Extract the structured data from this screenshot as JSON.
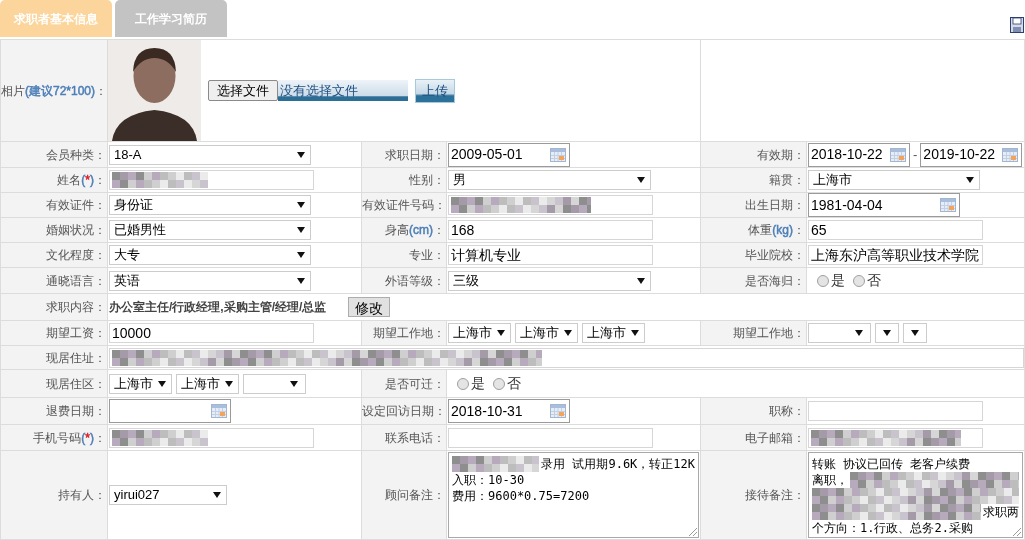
{
  "tabs": [
    {
      "label": "求职者基本信息",
      "selected": true
    },
    {
      "label": "工作学习简历",
      "selected": false
    }
  ],
  "form": {
    "rows": [
      {
        "fields": [
          {
            "label": [
              {
                "text": "相片"
              },
              {
                "text": "(建议72*100)",
                "color": "#4d7fb7"
              },
              {
                "text": "："
              }
            ],
            "kind": "photo",
            "choose_button": "选择文件",
            "file_status": "没有选择文件",
            "upload_button": "上传"
          }
        ]
      },
      {
        "fields": [
          {
            "label": "会员种类：",
            "kind": "select",
            "value": "18-A"
          },
          {
            "label": "求职日期：",
            "kind": "date",
            "value": "2009-05-01"
          },
          {
            "label": "有效期：",
            "kind": "date_range",
            "from": "2018-10-22",
            "separator": "-",
            "to": "2019-10-22"
          }
        ]
      },
      {
        "fields": [
          {
            "label": [
              {
                "text": "姓名"
              },
              {
                "text": "(",
                "color": "#4d7fb7"
              },
              {
                "text": "*",
                "color": "#e0202a"
              },
              {
                "text": ")",
                "color": "#4d7fb7"
              },
              {
                "text": "："
              }
            ],
            "kind": "text",
            "redacted": true
          },
          {
            "label": "性别：",
            "kind": "select",
            "value": "男"
          },
          {
            "label": "籍贯：",
            "kind": "select",
            "value": "上海市"
          }
        ]
      },
      {
        "fields": [
          {
            "label": "有效证件：",
            "kind": "select",
            "value": "身份证"
          },
          {
            "label": "有效证件号码：",
            "kind": "text",
            "redacted": true
          },
          {
            "label": "出生日期：",
            "kind": "date",
            "value": "1981-04-04"
          }
        ]
      },
      {
        "fields": [
          {
            "label": "婚姻状况：",
            "kind": "select",
            "value": "已婚男性"
          },
          {
            "label": [
              {
                "text": "身高"
              },
              {
                "text": "(cm)",
                "color": "#4d7fb7"
              },
              {
                "text": "："
              }
            ],
            "kind": "text",
            "value": "168"
          },
          {
            "label": [
              {
                "text": "体重"
              },
              {
                "text": "(kg)",
                "color": "#4d7fb7"
              },
              {
                "text": "："
              }
            ],
            "kind": "text",
            "value": "65"
          }
        ]
      },
      {
        "fields": [
          {
            "label": "文化程度：",
            "kind": "select",
            "value": "大专"
          },
          {
            "label": "专业：",
            "kind": "text",
            "value": "计算机专业"
          },
          {
            "label": "毕业院校：",
            "kind": "text",
            "value": "上海东沪高等职业技术学院"
          }
        ]
      },
      {
        "fields": [
          {
            "label": "通晓语言：",
            "kind": "select",
            "value": "英语"
          },
          {
            "label": "外语等级：",
            "kind": "select",
            "value": "三级"
          },
          {
            "label": "是否海归：",
            "kind": "radio",
            "options": [
              {
                "label": "是",
                "selected": false
              },
              {
                "label": "否",
                "selected": false
              }
            ]
          }
        ]
      },
      {
        "fields": [
          {
            "label": "求职内容：",
            "kind": "summary",
            "value": "办公室主任/行政经理,采购主管/经理/总监",
            "button": "修改"
          }
        ]
      },
      {
        "fields": [
          {
            "label": "期望工资：",
            "kind": "text",
            "value": "10000"
          },
          {
            "label": "期望工作地：",
            "kind": "selects",
            "selects": [
              {
                "kind": "choice",
                "value": "上海市"
              },
              {
                "kind": "choice",
                "value": "上海市"
              },
              {
                "kind": "choice",
                "value": "上海市"
              }
            ]
          },
          {
            "label": "期望工作地：",
            "kind": "selects",
            "selects": [
              {
                "kind": "empty"
              },
              {
                "kind": "empty"
              },
              {
                "kind": "empty"
              }
            ]
          }
        ]
      },
      {
        "fields": [
          {
            "label": "现居住址：",
            "kind": "text",
            "redacted": true
          }
        ]
      },
      {
        "fields": [
          {
            "label": "现居住区：",
            "kind": "selects",
            "selects": [
              {
                "kind": "choice",
                "value": "上海市"
              },
              {
                "kind": "choice",
                "value": "上海市"
              },
              {
                "kind": "empty"
              }
            ]
          },
          {
            "label": "是否可迁：",
            "kind": "radio",
            "options": [
              {
                "label": "是",
                "selected": false
              },
              {
                "label": "否",
                "selected": false
              }
            ]
          }
        ]
      },
      {
        "fields": [
          {
            "label": "退费日期：",
            "kind": "date"
          },
          {
            "label": "设定回访日期：",
            "kind": "date",
            "value": "2018-10-31"
          },
          {
            "label": "职称：",
            "kind": "text"
          }
        ]
      },
      {
        "fields": [
          {
            "label": [
              {
                "text": "手机号码"
              },
              {
                "text": "(",
                "color": "#4d7fb7"
              },
              {
                "text": "*",
                "color": "#e0202a"
              },
              {
                "text": ")",
                "color": "#4d7fb7"
              },
              {
                "text": "："
              }
            ],
            "kind": "text",
            "redacted": true
          },
          {
            "label": "联系电话：",
            "kind": "text"
          },
          {
            "label": "电子邮箱：",
            "kind": "text",
            "redacted": true
          }
        ]
      },
      {
        "fields": [
          {
            "label": "持有人：",
            "kind": "select",
            "value": "yirui027"
          },
          {
            "label": "顾问备注：",
            "kind": "textarea",
            "lines": [
              [
                {
                  "kind": "redacted"
                },
                {
                  "kind": "text",
                  "text": "录用 试用期9.6K，转正12K"
                }
              ],
              [
                {
                  "kind": "text",
                  "text": "入职：10-30"
                }
              ],
              [
                {
                  "kind": "text",
                  "text": "费用：9600*0.75=7200"
                }
              ]
            ]
          },
          {
            "label": "接待备注：",
            "kind": "textarea",
            "lines": [
              [
                {
                  "kind": "text",
                  "text": "转账 协议已回传 老客户续费"
                }
              ],
              [
                {
                  "kind": "text",
                  "text": "离职，"
                },
                {
                  "kind": "redacted"
                }
              ],
              [
                {
                  "kind": "redacted"
                }
              ],
              [
                {
                  "kind": "redacted"
                },
                {
                  "kind": "text",
                  "text": "求职两"
                }
              ],
              [
                {
                  "kind": "text",
                  "text": "个方向：1.行政、总务2.采购"
                }
              ]
            ]
          }
        ]
      }
    ]
  }
}
